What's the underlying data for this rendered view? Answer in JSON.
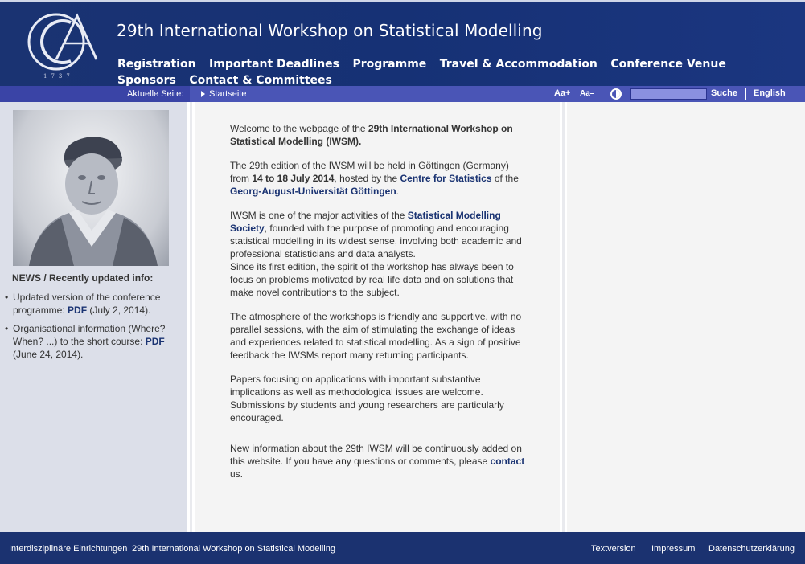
{
  "header": {
    "logo_icon": "university-logo-seal",
    "logo_text": "1737",
    "title": "29th International Workshop on Statistical Modelling",
    "nav": [
      "Registration",
      "Important Deadlines",
      "Programme",
      "Travel & Accommodation",
      "Conference Venue",
      "Sponsors",
      "Contact & Committees"
    ]
  },
  "toolbar": {
    "breadcrumb_label": "Aktuelle Seite:",
    "breadcrumb_current": "Startseite",
    "font_increase": "Aa+",
    "font_decrease": "Aa–",
    "contrast_icon": "contrast-icon",
    "search_label": "Suche",
    "language_label": "English"
  },
  "sidebar": {
    "portrait_icon": "portrait-image",
    "news_heading": "NEWS / Recently updated info:",
    "news": [
      {
        "text_before": "Updated version of the conference programme: ",
        "link": "PDF",
        "text_after": " (July 2, 2014)."
      },
      {
        "text_before": "Organisational information (Where? When? ...) to the short course: ",
        "link": "PDF",
        "text_after": " (June 24, 2014)."
      }
    ]
  },
  "content": {
    "p1_a": "Welcome to the webpage of the ",
    "p1_b": "29th International Workshop on Statistical Modelling (IWSM).",
    "p2_a": "The 29th edition of the IWSM will be held in Göttingen (Germany) from ",
    "p2_b": "14 to 18 July 2014",
    "p2_c": ", hosted by the ",
    "p2_link1": "Centre for Statistics",
    "p2_d": " of the ",
    "p2_link2": "Georg-August-Universität Göttingen",
    "p2_e": ".",
    "p3_a": "IWSM is one of the major activities of the ",
    "p3_link": "Statistical Modelling Society",
    "p3_b": ", founded with the purpose of promoting and encouraging statistical modelling in its widest sense, involving both academic and professional statisticians and data analysts.",
    "p3_c": "Since its first edition, the spirit of the workshop has always been to focus on problems motivated by real life data and on solutions that make novel contributions to the subject.",
    "p4": "The atmosphere of the workshops is friendly and supportive, with no parallel sessions, with the aim of stimulating the exchange of ideas and experiences related to statistical modelling. As a sign of positive feedback the IWSMs report many returning participants.",
    "p5": "Papers focusing on applications with important substantive implications as well as methodological issues are welcome. Submissions by students and young researchers are particularly encouraged.",
    "p6_a": "New information about the 29th IWSM will be continuously added on this website. If you have any questions or comments, please ",
    "p6_link": "contact",
    "p6_b": " us."
  },
  "footer": {
    "left1": "Interdisziplinäre Einrichtungen",
    "left2": "29th International Workshop on Statistical Modelling",
    "right1": "Textversion",
    "right2": "Impressum",
    "right3": "Datenschutzerklärung"
  },
  "colors": {
    "header_bg": "#1a3372",
    "toolbar_bg": "#4a55b6",
    "link": "#1a3372",
    "sidebar_bg": "#dcdfe9",
    "content_bg": "#f4f4f4"
  }
}
